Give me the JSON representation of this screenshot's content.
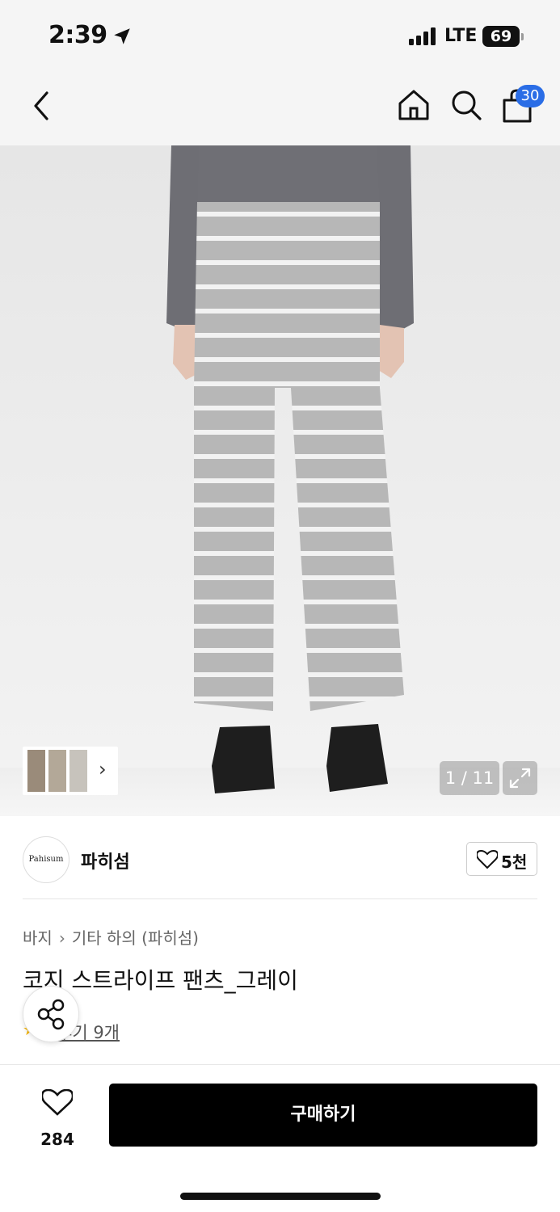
{
  "status_bar": {
    "time": "2:39",
    "network": "LTE",
    "battery": "69"
  },
  "nav": {
    "cart_count": "30"
  },
  "gallery": {
    "counter": "1 / 11"
  },
  "brand": {
    "logo_text": "Pahisum",
    "name": "파히섬",
    "like_count": "5천"
  },
  "breadcrumb": {
    "category": "바지",
    "subcategory": "기타 하의 (파히섬)"
  },
  "product": {
    "title": "코지 스트라이프 팬츠_그레이",
    "reviews": "후기 9개"
  },
  "bottom_bar": {
    "wish_count": "284",
    "buy_label": "구매하기"
  },
  "colors": {
    "badge": "#2a6de6",
    "buy_button": "#000000",
    "star": "#f5b400"
  }
}
